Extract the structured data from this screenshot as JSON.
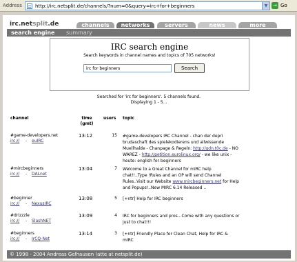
{
  "browser": {
    "address_label": "Address",
    "url": "http://irc.netsplit.de/channels/?num=0&query=irc+for+beginners",
    "go_label": "Go"
  },
  "site": {
    "logo_main": "irc.net",
    "logo_split": "split",
    "logo_tld": ".de"
  },
  "tabs": [
    {
      "label": "channels"
    },
    {
      "label": "networks"
    },
    {
      "label": "servers"
    },
    {
      "label": "news"
    },
    {
      "label": "more"
    }
  ],
  "subnav": {
    "active": "search engine",
    "summary": "summary"
  },
  "search": {
    "title": "IRC search engine",
    "description": "Search keywords in channel names and topics of 705 networks!",
    "query": "irc for beginners",
    "button_label": "Search"
  },
  "results": {
    "summary": "Searched for 'irc for beginners'. 5 channels found.",
    "range": "Displaying 1 - 5...",
    "headers": {
      "channel": "channel",
      "time": "time",
      "time_unit": "(gmt)",
      "users": "users",
      "topic": "topic"
    },
    "rows": [
      {
        "channel": "#game-developers.net",
        "proto": "irc://",
        "sep": "-",
        "network": "euIRC",
        "time": "13:12",
        "users": "15",
        "topic_lines": [
          "#game-developers IRC Channel - chan der depri",
          "brudaschaft des spielekodierens und allwissende",
          "Muellhalde - Chanpage & Regeln:"
        ],
        "topic_link1": "http://gdn.t0c.de",
        "topic_after1": " - NO",
        "topic_line4": "WAREZ - ",
        "topic_link2": "http://petition.eurolinux.org/",
        "topic_after2": " - we like unix -",
        "topic_line5": "heute: english for beginners"
      },
      {
        "channel": "#mircbeginners",
        "proto": "irc://",
        "sep": "-",
        "network": "DALnet",
        "time": "13:04",
        "users": "7",
        "topic_a": "Welcome to a Great Channel for mIRC help",
        "topic_b": "chat!!..Type !Rules and an OP will send Channel",
        "topic_c": "Rules..Visit our Website ",
        "topic_link": "www.mircbeginners.net",
        "topic_c_after": " for Help",
        "topic_d": "and Popups!..New MIRC 6.14 Released .."
      },
      {
        "channel": "#beginner",
        "proto": "irc://",
        "sep": "-",
        "network": "NexusIRC",
        "time": "13:08",
        "users": "5",
        "topic_a": "[+ntr] Help for IRC beginners"
      },
      {
        "channel": "#drizzzle",
        "proto": "irc://",
        "sep": "-",
        "network": "SlashNET",
        "time": "13:09",
        "users": "4",
        "topic_a": "IRC for beginners and pros...Come with any questions or",
        "topic_b": "just to chat!!!"
      },
      {
        "channel": "#beginners",
        "proto": "irc://",
        "sep": "-",
        "network": "IrCQ-Net",
        "time": "13:14",
        "users": "3",
        "topic_a": "[+ntr] Friendly Place for Clean Chat, Help for IRC &",
        "topic_b": "mIRC"
      }
    ]
  },
  "footer": {
    "text": "© 1998 - 2004   Andreas Gelhausen   (atte at netsplit.de)"
  }
}
